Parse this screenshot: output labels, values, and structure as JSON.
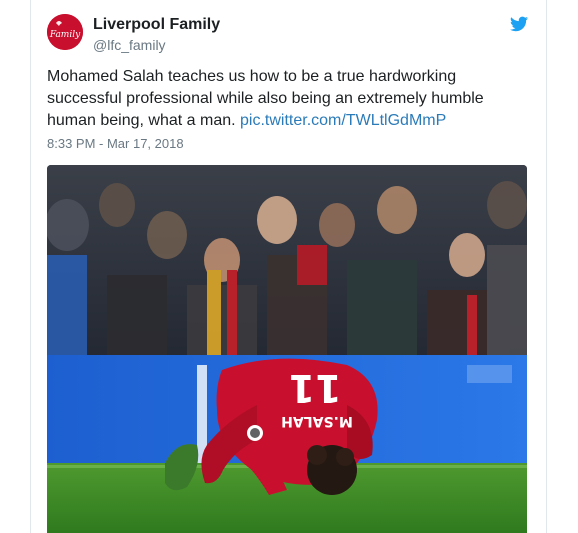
{
  "tweet": {
    "display_name": "Liverpool Family",
    "handle": "@lfc_family",
    "text": "Mohamed Salah teaches us how to be a true hardworking successful professional while also being an extremely humble human being, what a man.",
    "link": "pic.twitter.com/TWLtlGdMmP",
    "timestamp": "8:33 PM - Mar 17, 2018"
  },
  "avatar": {
    "logo_text": "Family",
    "icon": "liverpool-family-logo"
  },
  "media": {
    "jersey_number": "11",
    "jersey_name": "M.SALAH",
    "icon": "photo"
  },
  "colors": {
    "text": "#1c2022",
    "secondary": "#697882",
    "link": "#2b7bb9",
    "twitter_blue": "#1da1f2",
    "liverpool_red": "#c8102e"
  }
}
